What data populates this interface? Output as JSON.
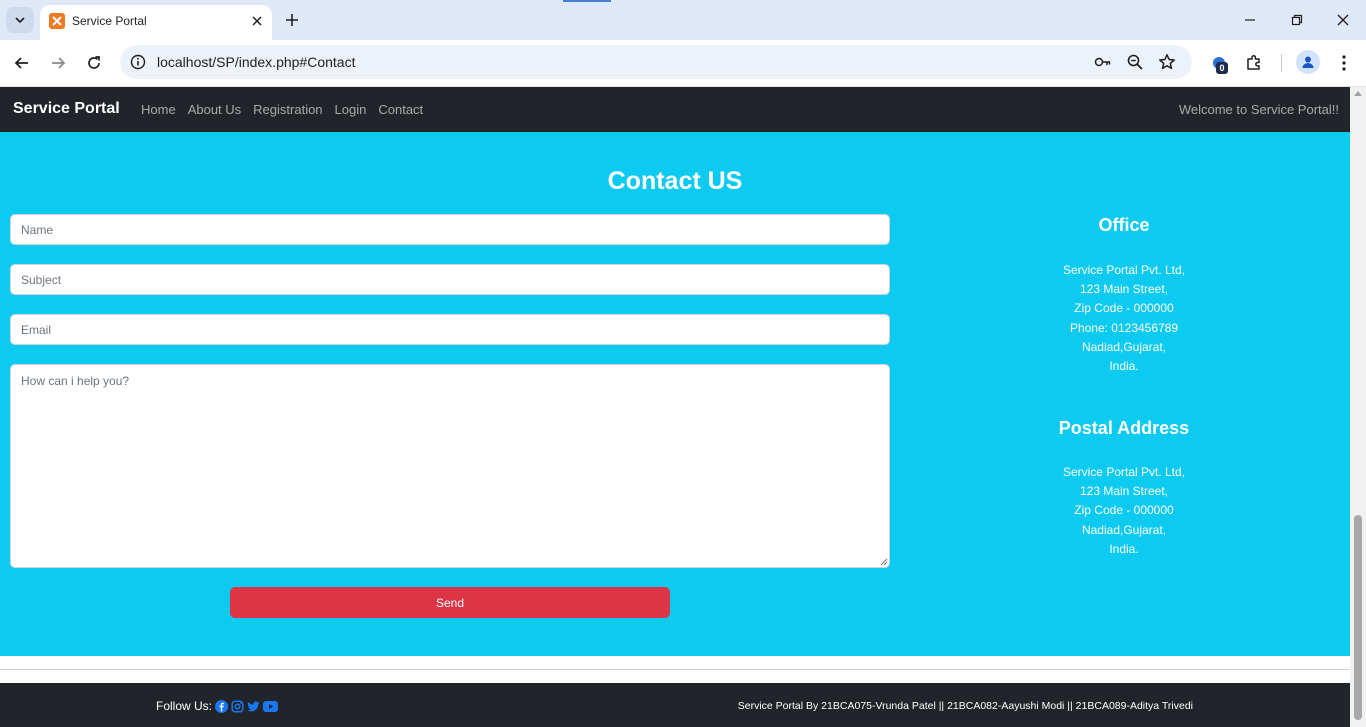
{
  "browser": {
    "tab": {
      "title": "Service Portal",
      "favicon": "xampp-icon"
    },
    "url": "localhost/SP/index.php#Contact",
    "extension_badge": "0"
  },
  "site": {
    "brand": "Service Portal",
    "nav": {
      "items": [
        {
          "label": "Home"
        },
        {
          "label": "About Us"
        },
        {
          "label": "Registration"
        },
        {
          "label": "Login"
        },
        {
          "label": "Contact"
        }
      ],
      "welcome": "Welcome to Service Portal!!"
    }
  },
  "contact": {
    "title": "Contact US",
    "form": {
      "name_placeholder": "Name",
      "subject_placeholder": "Subject",
      "email_placeholder": "Email",
      "message_placeholder": "How can i help you?",
      "send_label": "Send"
    },
    "office": {
      "heading": "Office",
      "lines": [
        "Service Portal Pvt. Ltd,",
        "123 Main Street,",
        "Zip Code - 000000",
        "Phone: 0123456789",
        "Nadiad,Gujarat,",
        "India."
      ]
    },
    "postal": {
      "heading": "Postal Address",
      "lines": [
        "Service Portal Pvt. Ltd,",
        "123 Main Street,",
        "Zip Code - 000000",
        "Nadiad,Gujarat,",
        "India."
      ]
    }
  },
  "footer": {
    "follow_label": "Follow Us:",
    "social_icons": [
      "facebook-icon",
      "instagram-icon",
      "twitter-icon",
      "youtube-icon"
    ],
    "credits": "Service Portal By 21BCA075-Vrunda Patel || 21BCA082-Aayushi Modi || 21BCA089-Aditya Trivedi"
  },
  "colors": {
    "contact_bg": "#0dcaf0",
    "navbar_bg": "#212529",
    "send_button": "#dc3545",
    "social_icon": "#1877f2"
  }
}
